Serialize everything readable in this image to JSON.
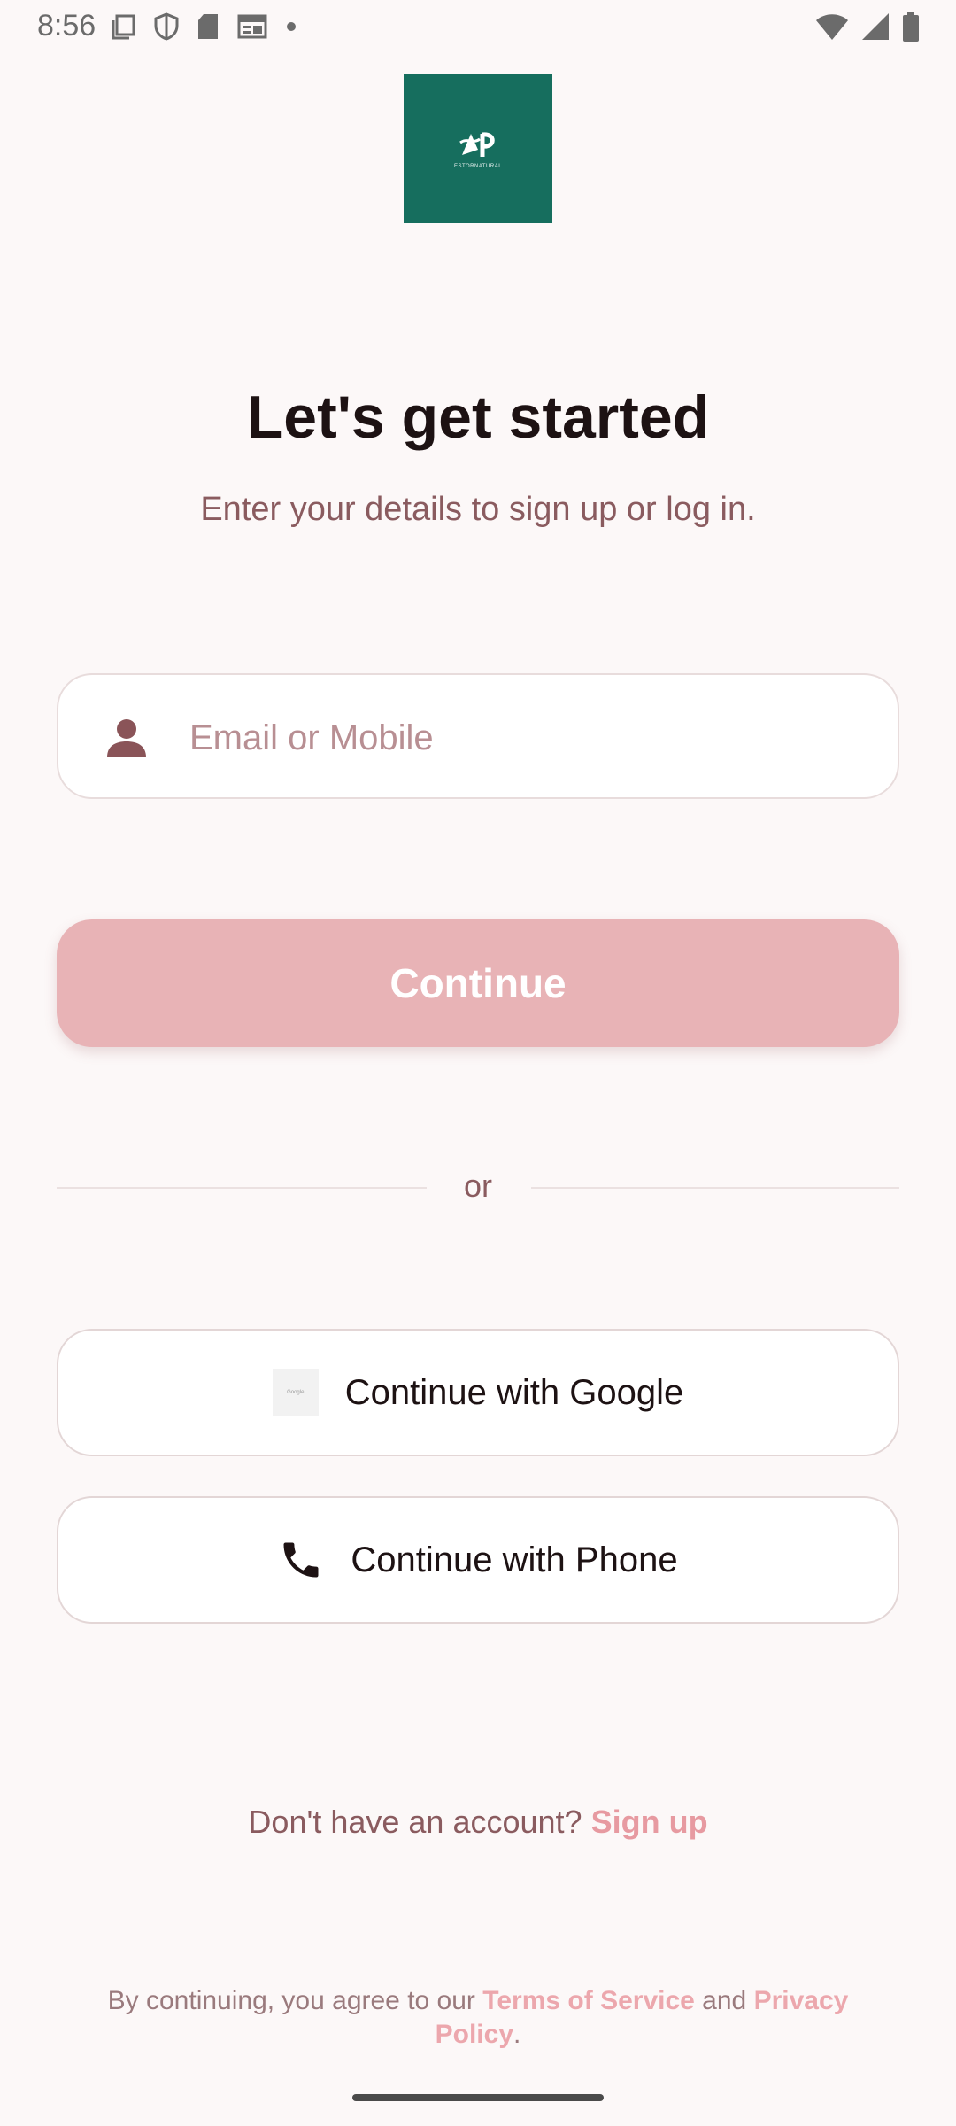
{
  "status_bar": {
    "time": "8:56",
    "left_icons": [
      "screenshot-icon",
      "shield-icon",
      "sd-card-icon",
      "news-icon",
      "dot-icon"
    ],
    "right_icons": [
      "wifi-icon",
      "signal-icon",
      "battery-icon"
    ]
  },
  "logo": {
    "mark": "AP",
    "name": "ESTORNATURAL",
    "color": "#166e5e"
  },
  "header": {
    "title": "Let's get started",
    "subtitle": "Enter your details to sign up or log in."
  },
  "login_form": {
    "identifier_placeholder": "Email or Mobile",
    "identifier_value": "",
    "continue_label": "Continue",
    "continue_color": "#e8b3b6"
  },
  "divider": {
    "label": "or"
  },
  "social": {
    "google_label": "Continue with Google",
    "google_icon_text": "Google",
    "phone_label": "Continue with Phone"
  },
  "signup": {
    "prompt": "Don't have an account?",
    "link": "Sign up"
  },
  "terms": {
    "prefix": "By continuing, you agree to our",
    "terms_link": "Terms of Service",
    "conjunction": "and",
    "privacy_link": "Privacy Policy",
    "suffix": "."
  },
  "colors": {
    "background": "#fcf8f8",
    "accent": "#e79aa1",
    "secondary_text": "#8a5b5f"
  }
}
